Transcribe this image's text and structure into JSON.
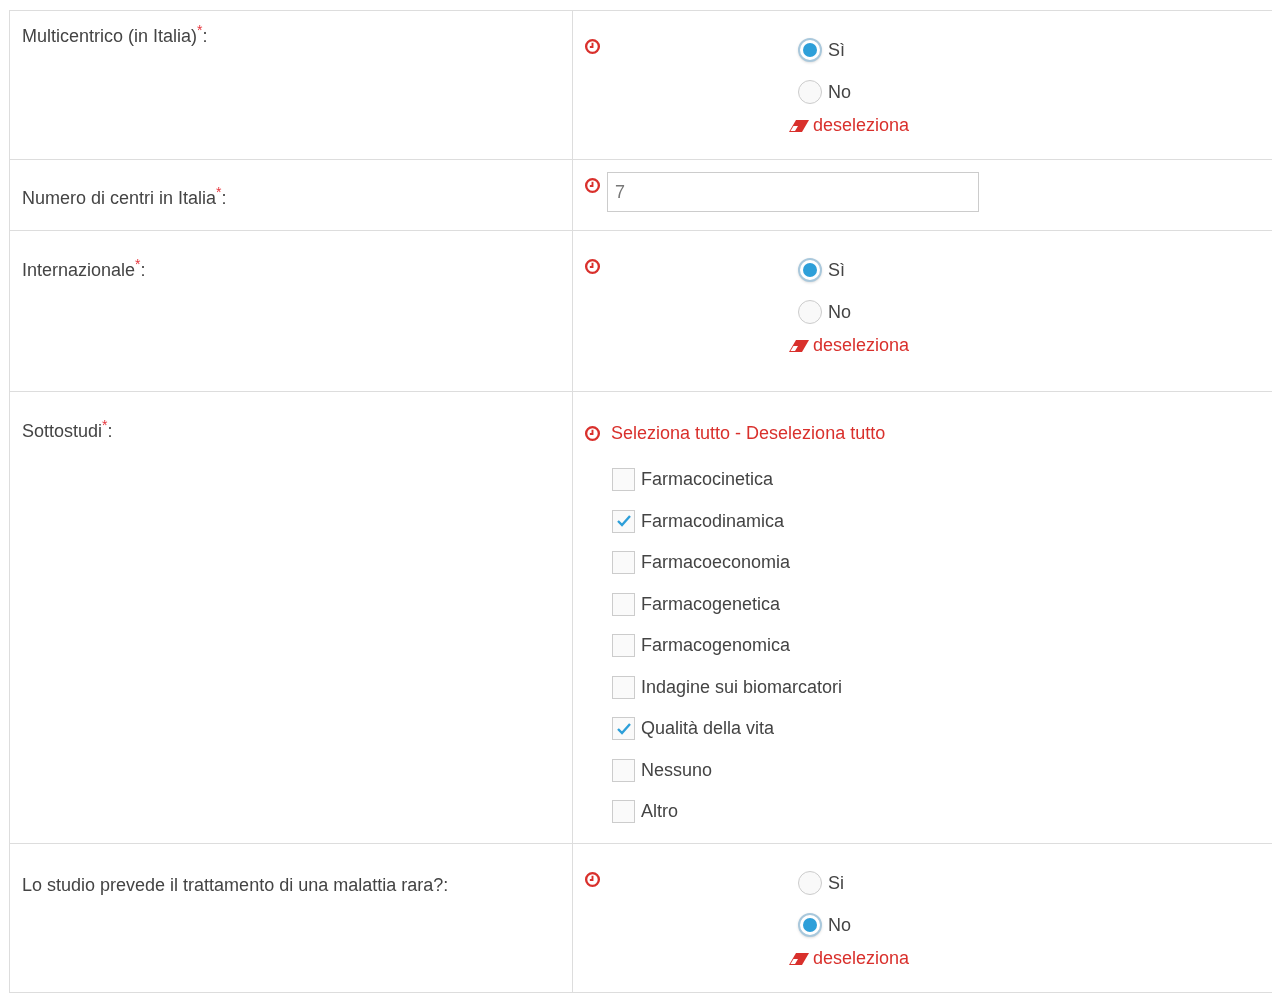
{
  "fields": [
    {
      "kind": "radio",
      "label": "Multicentrico (in Italia)$^{*}$:",
      "options": [
        {
          "label": "Sì",
          "selected": true
        },
        {
          "label": "No",
          "selected": false
        }
      ],
      "clear_link": "deseleziona"
    },
    {
      "kind": "text",
      "label": "Numero di centri in Italia$^{*}$:",
      "value": "7"
    },
    {
      "kind": "radio",
      "label": "Internazionale$^{*}$:",
      "options": [
        {
          "label": "Sì",
          "selected": true
        },
        {
          "label": "No",
          "selected": false
        }
      ],
      "clear_link": "deseleziona"
    },
    {
      "kind": "checkboxes",
      "label": "Sottostudi$^{*}$:",
      "select_all": "Seleziona tutto",
      "separator": "-",
      "deselect_all": "Deseleziona tutto",
      "options": [
        {
          "label": "Farmacocinetica",
          "checked": false
        },
        {
          "label": "Farmacodinamica",
          "checked": true
        },
        {
          "label": "Farmacoeconomia",
          "checked": false
        },
        {
          "label": "Farmacogenetica",
          "checked": false
        },
        {
          "label": "Farmacogenomica",
          "checked": false
        },
        {
          "label": "Indagine sui biomarcatori",
          "checked": false
        },
        {
          "label": "Qualità della vita",
          "checked": true
        },
        {
          "label": "Nessuno",
          "checked": false
        },
        {
          "label": "Altro",
          "checked": false
        }
      ]
    },
    {
      "kind": "radio",
      "label": "Lo studio prevede il trattamento di una malattia rara?:",
      "options": [
        {
          "label": "Si",
          "selected": false
        },
        {
          "label": "No",
          "selected": true
        }
      ],
      "clear_link": "deseleziona"
    }
  ]
}
